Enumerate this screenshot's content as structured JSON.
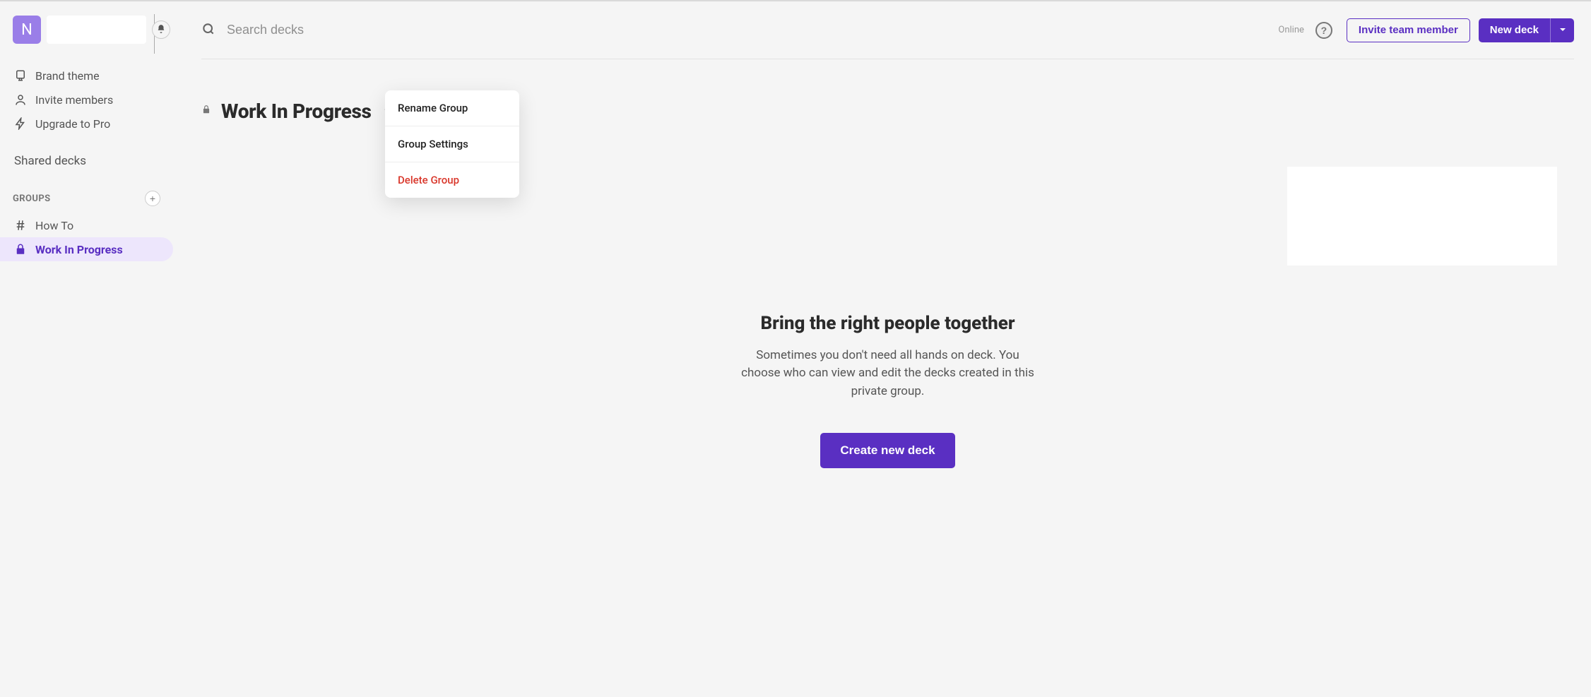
{
  "sidebar": {
    "avatar_initial": "N",
    "nav": [
      {
        "icon": "palette",
        "label": "Brand theme"
      },
      {
        "icon": "user",
        "label": "Invite members"
      },
      {
        "icon": "bolt",
        "label": "Upgrade to Pro"
      }
    ],
    "shared_decks_label": "Shared decks",
    "groups_header": "GROUPS",
    "groups": [
      {
        "icon": "hash",
        "label": "How To",
        "active": false
      },
      {
        "icon": "lock",
        "label": "Work In Progress",
        "active": true
      }
    ]
  },
  "header": {
    "search_placeholder": "Search decks",
    "status": "Online",
    "invite_btn": "Invite team member",
    "new_deck_btn": "New deck"
  },
  "page": {
    "title": "Work In Progress",
    "menu": {
      "rename": "Rename Group",
      "settings": "Group Settings",
      "delete": "Delete Group"
    }
  },
  "empty_state": {
    "title": "Bring the right people together",
    "description": "Sometimes you don't need all hands on deck. You choose who can view and edit the decks created in this private group.",
    "cta": "Create new deck"
  }
}
